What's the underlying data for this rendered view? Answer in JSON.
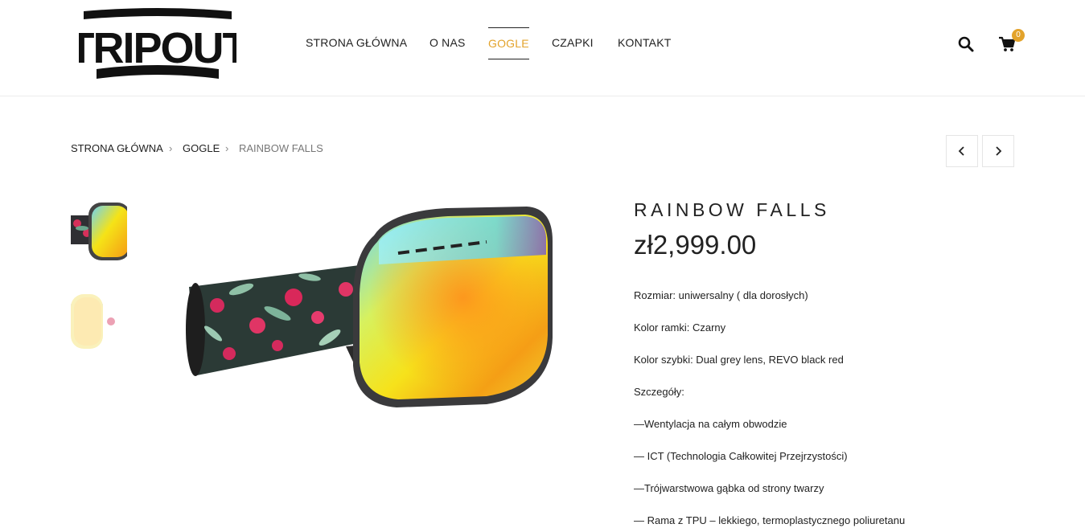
{
  "brand": {
    "logo_text": "TRIPOUT"
  },
  "nav": {
    "items": [
      {
        "label": "STRONA GŁÓWNA"
      },
      {
        "label": "O NAS"
      },
      {
        "label": "GOGLE"
      },
      {
        "label": "CZAPKI"
      },
      {
        "label": "KONTAKT"
      }
    ],
    "active_index": 2
  },
  "header_icons": {
    "search": "search-icon",
    "cart": "shopping-cart-icon",
    "cart_count": "0"
  },
  "breadcrumb": [
    "STRONA GŁÓWNA",
    "GOGLE",
    "RAINBOW FALLS"
  ],
  "pager": {
    "prev": "chevron-left-icon",
    "next": "chevron-right-icon"
  },
  "product": {
    "title": "RAINBOW FALLS",
    "price": "zł2,999.00",
    "description": [
      "Rozmiar: uniwersalny ( dla dorosłych)",
      "Kolor ramki: Czarny",
      "Kolor szybki: Dual grey lens, REVO black red",
      "Szczegóły:",
      "—Wentylacja na całym obwodzie",
      "— ICT (Technologia Całkowitej Przejrzystości)",
      "—Trójwarstwowa gąbka od strony twarzy",
      "— Rama z TPU – lekkiego, termoplastycznego poliuretanu"
    ]
  },
  "colors": {
    "accent": "#e3a32b",
    "text": "#222222",
    "muted": "#777777"
  }
}
